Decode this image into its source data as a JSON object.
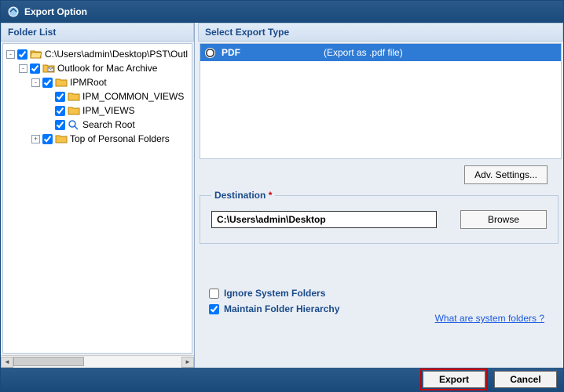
{
  "window": {
    "title": "Export Option"
  },
  "folder_list": {
    "header": "Folder List",
    "items": [
      {
        "indent": 0,
        "expander": "-",
        "checked": true,
        "icon": "folder-open",
        "label": "C:\\Users\\admin\\Desktop\\PST\\Outl"
      },
      {
        "indent": 1,
        "expander": "-",
        "checked": true,
        "icon": "mailbox",
        "label": "Outlook for Mac Archive"
      },
      {
        "indent": 2,
        "expander": "-",
        "checked": true,
        "icon": "folder",
        "label": "IPMRoot"
      },
      {
        "indent": 3,
        "expander": "",
        "checked": true,
        "icon": "folder",
        "label": "IPM_COMMON_VIEWS"
      },
      {
        "indent": 3,
        "expander": "",
        "checked": true,
        "icon": "folder",
        "label": "IPM_VIEWS"
      },
      {
        "indent": 3,
        "expander": "",
        "checked": true,
        "icon": "search",
        "label": "Search Root"
      },
      {
        "indent": 2,
        "expander": "+",
        "checked": true,
        "icon": "folder",
        "label": "Top of Personal Folders"
      }
    ]
  },
  "export_type": {
    "header": "Select Export Type",
    "options": [
      {
        "name": "PDF",
        "desc": "(Export as .pdf file)",
        "selected": true
      }
    ]
  },
  "buttons": {
    "adv_settings": "Adv. Settings...",
    "browse": "Browse",
    "export": "Export",
    "cancel": "Cancel"
  },
  "destination": {
    "label": "Destination",
    "value": "C:\\Users\\admin\\Desktop"
  },
  "options": {
    "ignore_system": {
      "label": "Ignore System Folders",
      "checked": false
    },
    "maintain_hierarchy": {
      "label": "Maintain Folder Hierarchy",
      "checked": true
    }
  },
  "link": {
    "what_system": "What are system folders ?"
  },
  "icons": {
    "folder_fill": "#f7c24a",
    "folder_stroke": "#b8860b",
    "search_stroke": "#2a6fd6"
  }
}
